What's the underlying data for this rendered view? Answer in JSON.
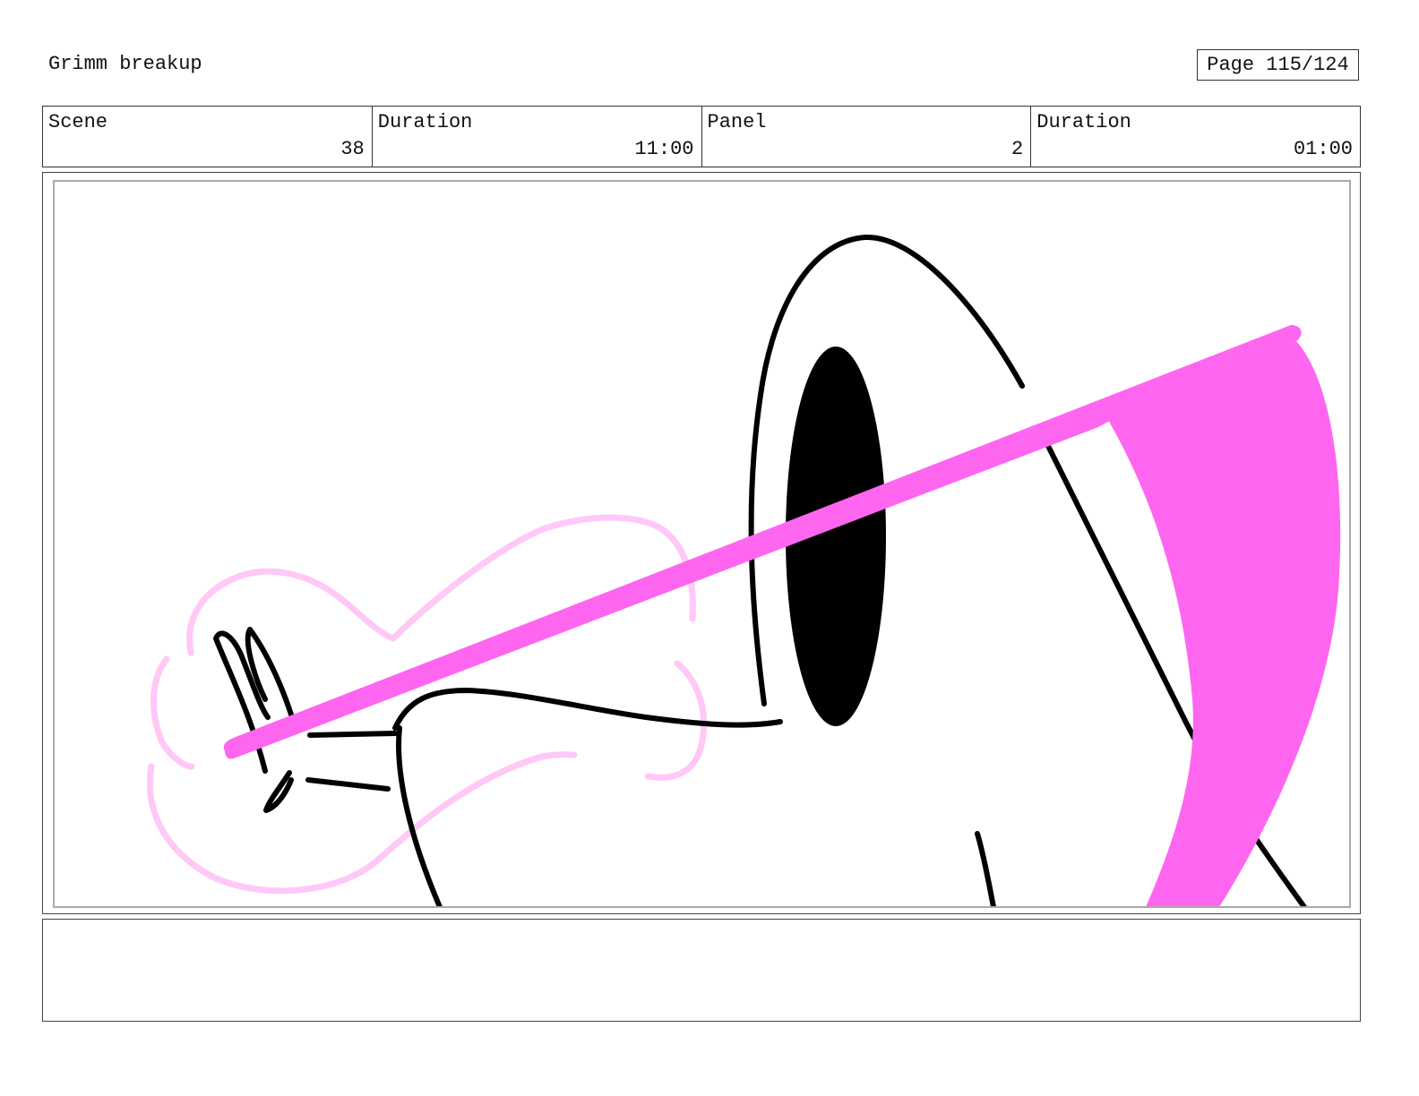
{
  "header": {
    "title": "Grimm breakup",
    "page_label": "Page 115/124"
  },
  "info": {
    "scene_label": "Scene",
    "scene_value": "38",
    "scene_duration_label": "Duration",
    "scene_duration_value": "11:00",
    "panel_label": "Panel",
    "panel_value": "2",
    "panel_duration_label": "Duration",
    "panel_duration_value": "01:00"
  },
  "notes": {
    "text": ""
  },
  "colors": {
    "beam": "#ff66f0",
    "ghost_outline": "#ffc8f6",
    "ink": "#000000"
  }
}
